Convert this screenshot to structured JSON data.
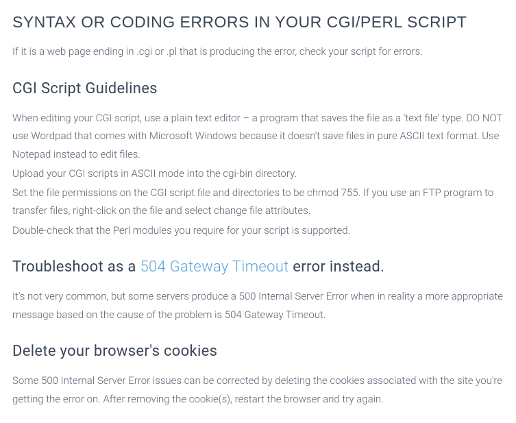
{
  "heading_main": "SYNTAX OR CODING ERRORS IN YOUR CGI/PERL SCRIPT",
  "intro": "If it is a web page ending in .cgi or .pl that is producing the error, check your script for errors.",
  "section1": {
    "heading": "CGI Script Guidelines",
    "p1": "When editing your CGI script, use a plain text editor – a program that saves the file as a 'text file' type. DO NOT use Wordpad that comes with Microsoft Windows because it doesn't save files in pure ASCII text format. Use Notepad instead to edit files.",
    "p2": "Upload your CGI scripts in ASCII mode into the cgi-bin directory.",
    "p3": "Set the file permissions on the CGI script file and directories to be chmod 755. If you use an FTP program to transfer files, right-click on the file and select change file attributes.",
    "p4": "Double-check that the Perl modules you require for your script is supported."
  },
  "section2": {
    "heading_pre": "Troubleshoot as a ",
    "heading_link": "504 Gateway Timeout",
    "heading_post": " error instead.",
    "p1": "It's not very common, but some servers produce a 500 Internal Server Error when in reality a more appropriate message based on the cause of the problem is 504 Gateway Timeout."
  },
  "section3": {
    "heading": "Delete your browser's cookies",
    "p1": "Some 500 Internal Server Error issues can be corrected by deleting the cookies associated with the site you're getting the error on. After removing the cookie(s), restart the browser and try again."
  }
}
